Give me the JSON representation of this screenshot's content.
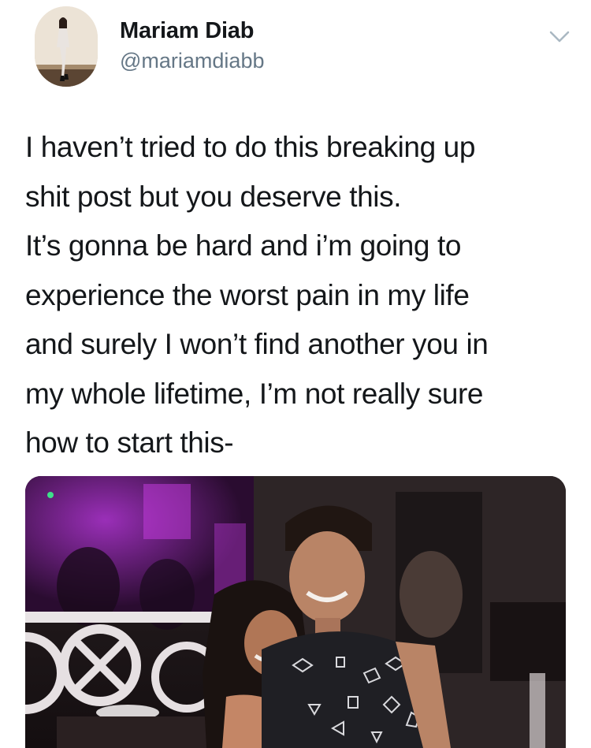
{
  "author": {
    "display_name": "Mariam Diab",
    "handle": "@mariamdiabb"
  },
  "tweet": {
    "lines": [
      "I haven’t tried to do this breaking up",
      "shit post but you deserve this.",
      "It’s gonna be hard and i’m going to",
      "experience the worst pain in my life",
      "and surely I won’t find another you in",
      "my whole lifetime, I’m not really sure",
      "how to start this-"
    ]
  },
  "icons": {
    "avatar": "profile-photo",
    "menu": "chevron-down-icon"
  },
  "colors": {
    "text_primary": "#14171a",
    "text_secondary": "#657786",
    "chevron": "#aab8c2"
  }
}
